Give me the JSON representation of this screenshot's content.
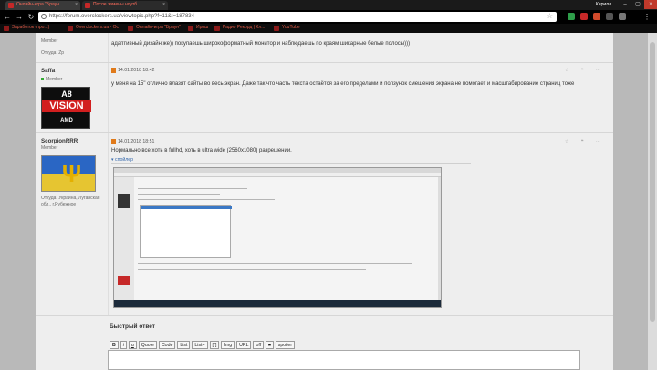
{
  "browser": {
    "tabs": [
      {
        "label": "Онлайн-игра \"Браун"
      },
      {
        "label": "После замены ноутб"
      }
    ],
    "user": "Кирилл",
    "url": "https://forum.overclockers.ua/viewtopic.php?f=11&t=187834",
    "bookmarks": [
      "Заработок (про...)",
      "Overclockers.ua - Ос",
      "Онлайн-игра \"Браун\"",
      "Ириш",
      "Радио Рекорд | Кл...",
      "YouTube"
    ]
  },
  "posts": [
    {
      "rank": "Member",
      "from": "Откуда: Zp",
      "text": "адаптивный дизайн же)) покупаешь широкоформатный монитор и наблюдаешь по краям шикарные белые полосы)))"
    },
    {
      "author": "Saffa",
      "rank": "Member",
      "date": "14.01.2018 18:42",
      "text": "у меня на 15\" отлично влазят сайты во весь экран. Даже так,что часть текста остаётся за его пределами и ползунок смещения экрана не помогает и масштабирование страниц тоже",
      "avatar": {
        "line1": "A8",
        "line2": "VISION",
        "line3": "AMD"
      }
    },
    {
      "author": "ScorpionRRR",
      "rank": "Member",
      "date": "14.01.2018 18:51",
      "from": "Откуда: Украина, Луганская обл., г.Рубежное",
      "text": "Нормально все хоть в fullhd, хоть в ultra wide (2560x1080) разрешении.",
      "spoiler": "спойлер"
    }
  ],
  "reply": {
    "title": "Быстрый ответ",
    "buttons": [
      "B",
      "i",
      "u",
      "Quote",
      "Code",
      "List",
      "List=",
      "[*]",
      "Img",
      "URL",
      "off",
      "s",
      "spoiler"
    ]
  }
}
